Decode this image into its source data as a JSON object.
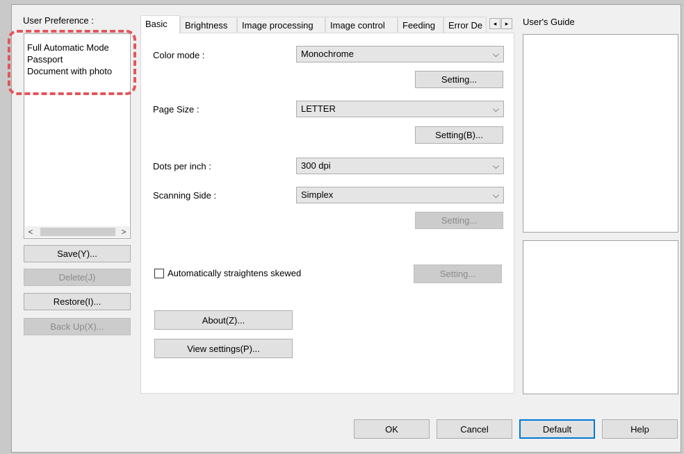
{
  "left": {
    "user_preference_label": "User Preference :",
    "preferences": [
      "Full Automatic Mode",
      "Passport",
      "Document with photo"
    ],
    "scroll_left": "<",
    "scroll_right": ">",
    "save_label": "Save(Y)...",
    "delete_label": "Delete(J)",
    "restore_label": "Restore(I)...",
    "backup_label": "Back Up(X)..."
  },
  "tabs": [
    "Basic",
    "Brightness",
    "Image processing",
    "Image control",
    "Feeding",
    "Error De"
  ],
  "tab_scroll": {
    "left": "◂",
    "right": "▸"
  },
  "basic": {
    "color_mode_label": "Color mode :",
    "color_mode_value": "Monochrome",
    "color_setting_label": "Setting...",
    "page_size_label": "Page Size :",
    "page_size_value": "LETTER",
    "page_setting_label": "Setting(B)...",
    "dpi_label": "Dots per inch :",
    "dpi_value": "300 dpi",
    "side_label": "Scanning Side :",
    "side_value": "Simplex",
    "side_setting_label": "Setting...",
    "skew_label": "Automatically straightens skewed",
    "skew_checked": false,
    "skew_setting_label": "Setting...",
    "about_label": "About(Z)...",
    "view_settings_label": "View settings(P)..."
  },
  "guide": {
    "title": "User's Guide"
  },
  "footer": {
    "ok_label": "OK",
    "cancel_label": "Cancel",
    "default_label": "Default",
    "help_label": "Help"
  },
  "colors": {
    "highlight": "#e3555a",
    "default_button_border": "#0078d7"
  },
  "icons": {
    "dropdown": "chevron-down-icon"
  }
}
